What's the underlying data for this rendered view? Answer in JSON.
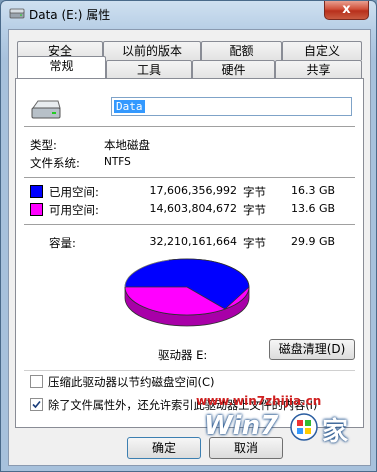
{
  "window": {
    "title": "Data (E:) 属性",
    "close_label": "x"
  },
  "tabs_row1": [
    "安全",
    "以前的版本",
    "配额",
    "自定义"
  ],
  "tabs_row2": [
    "常规",
    "工具",
    "硬件",
    "共享"
  ],
  "general": {
    "drive_name": "Data",
    "type_label": "类型:",
    "type_value": "本地磁盘",
    "fs_label": "文件系统:",
    "fs_value": "NTFS",
    "used": {
      "label": "已用空间:",
      "bytes": "17,606,356,992",
      "unit": "字节",
      "size": "16.3 GB",
      "color": "#0000ff"
    },
    "free": {
      "label": "可用空间:",
      "bytes": "14,603,804,672",
      "unit": "字节",
      "size": "13.6 GB",
      "color": "#ff00ff"
    },
    "capacity": {
      "label": "容量:",
      "bytes": "32,210,161,664",
      "unit": "字节",
      "size": "29.9 GB"
    },
    "drive_label": "驱动器 E:",
    "cleanup_button": "磁盘清理(D)"
  },
  "options": {
    "compress_label": "压缩此驱动器以节约磁盘空间(C)",
    "compress_checked": false,
    "index_label": "除了文件属性外，还允许索引此驱动器上文件的内容(I)",
    "index_checked": true
  },
  "buttons": {
    "ok": "确定",
    "cancel": "取消"
  },
  "watermark": {
    "url": "www.win7zhijia.cn",
    "logo_win": "Win7",
    "logo_home": "家"
  }
}
